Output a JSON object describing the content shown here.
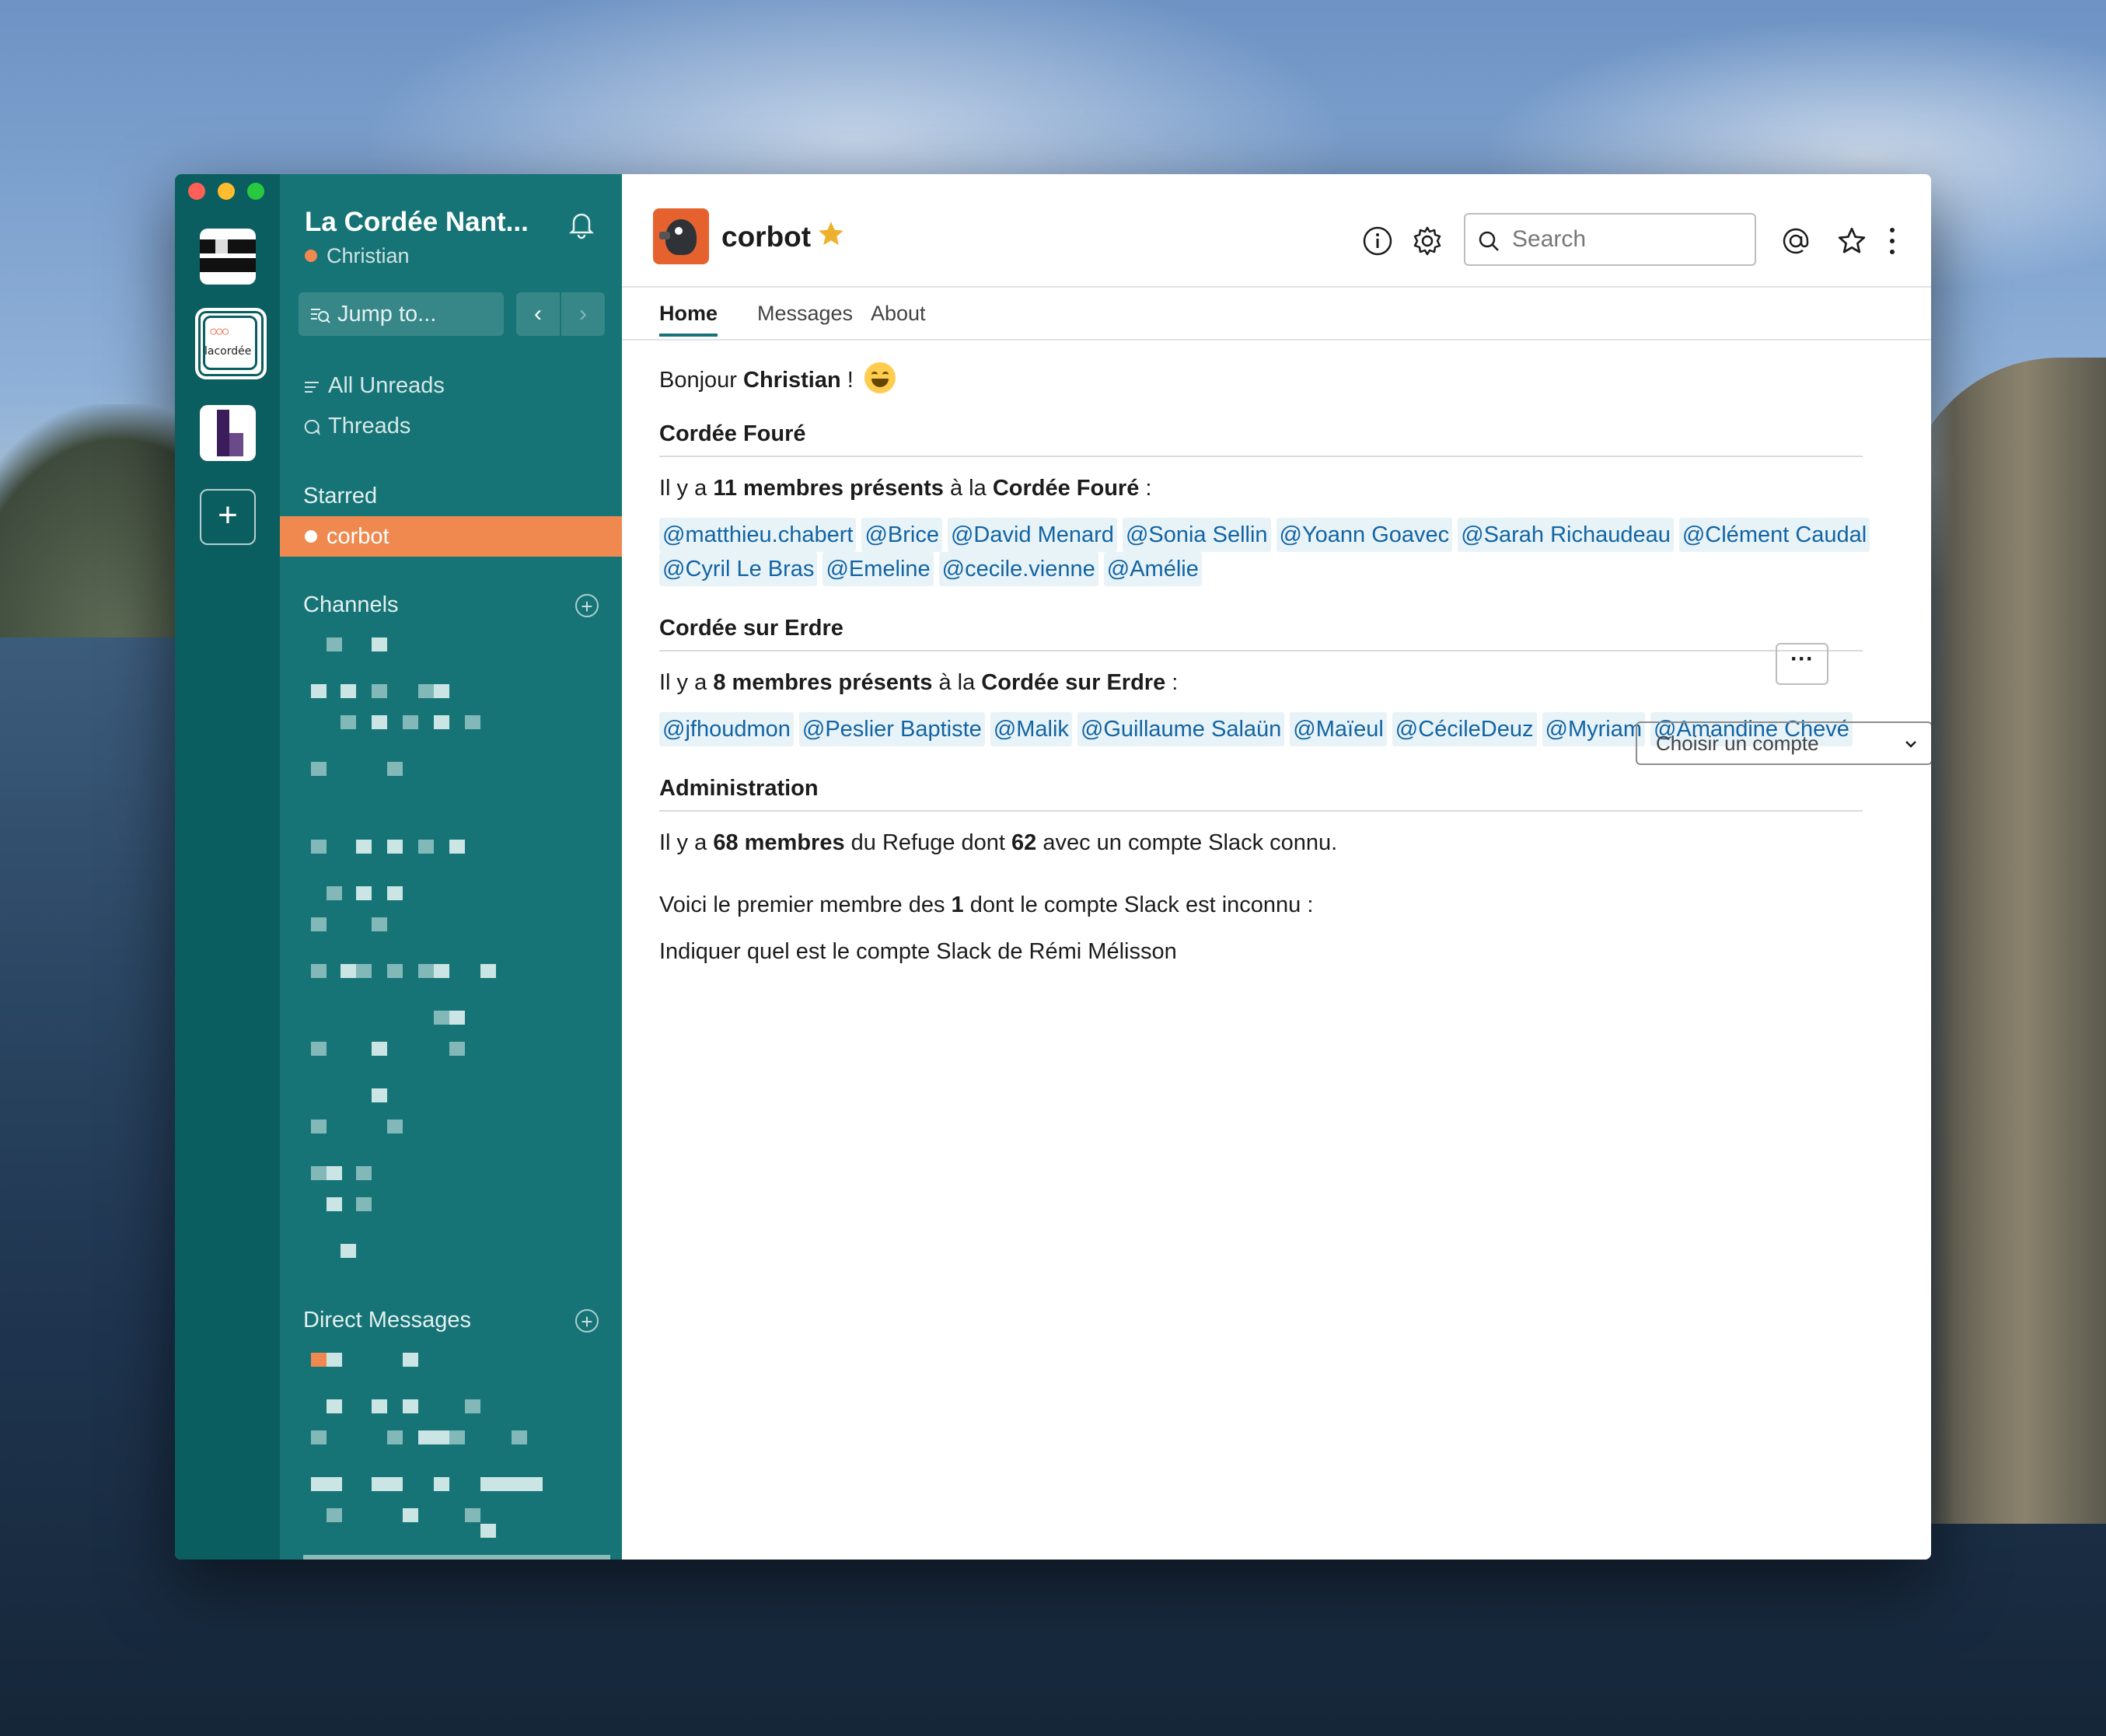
{
  "workspace": {
    "name": "La Cordée Nant...",
    "user": "Christian",
    "jump_placeholder": "Jump to...",
    "rail_logo_text": "lacordée"
  },
  "sidebar": {
    "all_unreads": "All Unreads",
    "threads": "Threads",
    "starred_header": "Starred",
    "starred_item": "corbot",
    "channels_header": "Channels",
    "dm_header": "Direct Messages"
  },
  "header": {
    "bot_name": "corbot",
    "search_placeholder": "Search"
  },
  "tabs": [
    "Home",
    "Messages",
    "About"
  ],
  "home": {
    "greeting_prefix": "Bonjour ",
    "greeting_name": "Christian",
    "greeting_suffix": " !",
    "section1": {
      "title": "Cordée Fouré",
      "t1": "Il y a ",
      "count": "11 membres présents",
      "t2": " à la ",
      "place": "Cordée Fouré",
      "t3": " :",
      "mentions": [
        "@matthieu.chabert",
        "@Brice",
        "@David Menard",
        "@Sonia Sellin",
        "@Yoann Goavec",
        "@Sarah Richaudeau",
        "@Clément Caudal",
        "@Cyril Le Bras",
        "@Emeline",
        "@cecile.vienne",
        "@Amélie"
      ]
    },
    "section2": {
      "title": "Cordée sur Erdre",
      "t1": "Il y a ",
      "count": "8 membres présents",
      "t2": " à la ",
      "place": "Cordée sur Erdre",
      "t3": " :",
      "mentions": [
        "@jfhoudmon",
        "@Peslier Baptiste",
        "@Malik",
        "@Guillaume Salaün",
        "@Maïeul",
        "@CécileDeuz",
        "@Myriam",
        "@Amandine Chevé"
      ]
    },
    "section3": {
      "title": "Administration",
      "a1": "Il y a ",
      "a_bold1": "68 membres",
      "a2": " du Refuge dont ",
      "a_bold2": "62",
      "a3": " avec un compte Slack connu.",
      "more_label": "···",
      "b1": "Voici le premier membre des ",
      "b_bold": "1",
      "b2": " dont le compte Slack est inconnu :",
      "c": "Indiquer quel est le compte Slack de Rémi Mélisson",
      "select_placeholder": "Choisir un compte"
    }
  }
}
